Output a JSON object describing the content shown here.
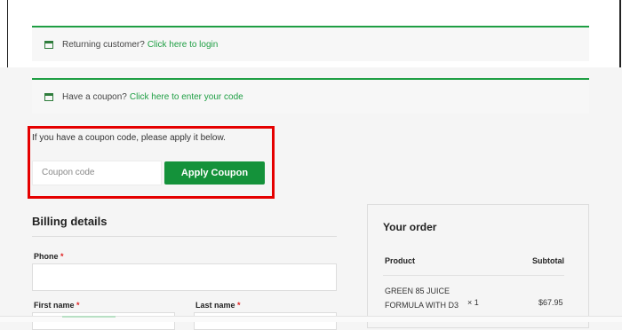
{
  "notices": {
    "returning": {
      "text": "Returning customer?",
      "link": "Click here to login"
    },
    "coupon": {
      "text": "Have a coupon?",
      "link": "Click here to enter your code"
    }
  },
  "coupon_form": {
    "instruction": "If you have a coupon code, please apply it below.",
    "input_placeholder": "Coupon code",
    "button_label": "Apply Coupon"
  },
  "billing": {
    "title": "Billing details",
    "phone_label": "Phone",
    "first_name_label": "First name",
    "last_name_label": "Last name",
    "required_mark": "*"
  },
  "order": {
    "title": "Your order",
    "col_product": "Product",
    "col_subtotal": "Subtotal",
    "items": [
      {
        "name": "GREEN 85 JUICE FORMULA WITH D3",
        "qty": "× 1",
        "price": "$67.95"
      }
    ]
  },
  "colors": {
    "accent": "#14923a",
    "highlight": "#e50000"
  }
}
